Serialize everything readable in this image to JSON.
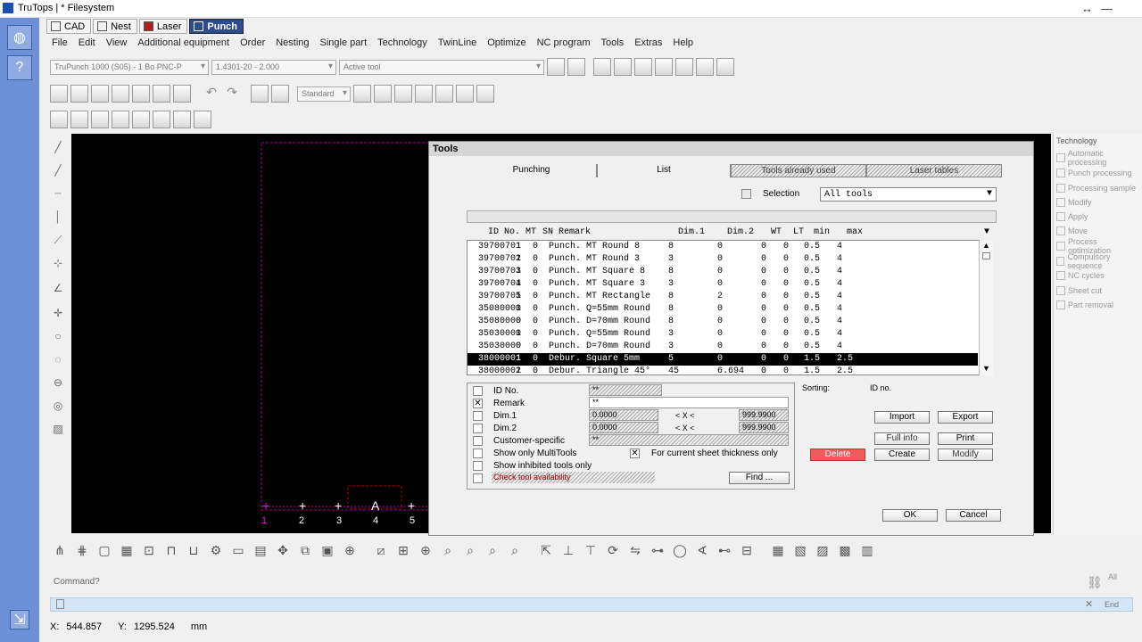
{
  "window": {
    "title": "TruTops | * Filesystem",
    "restore_icon": "restore-icon",
    "minimize_icon": "minimize-icon"
  },
  "mode_tabs": [
    {
      "label": "CAD",
      "icon": "cad-icon"
    },
    {
      "label": "Nest",
      "icon": "nest-icon"
    },
    {
      "label": "Laser",
      "icon": "laser-icon"
    },
    {
      "label": "Punch",
      "icon": "punch-icon",
      "active": true
    }
  ],
  "menu": [
    "File",
    "Edit",
    "View",
    "Additional equipment",
    "Order",
    "Nesting",
    "Single part",
    "Technology",
    "TwinLine",
    "Optimize",
    "NC program",
    "Tools",
    "Extras",
    "Help"
  ],
  "toolbar": {
    "machine": "TruPunch 1000 (S05) - 1 Bo PNC-P",
    "material": "1.4301-20 - 2.000",
    "tool": "Active tool",
    "style": "Standard"
  },
  "canvas": {
    "ruler_numbers": [
      "1",
      "2",
      "3",
      "4",
      "5"
    ]
  },
  "dialog": {
    "title": "Tools",
    "tabs": [
      {
        "label": "Punching",
        "state": "normal"
      },
      {
        "label": "List",
        "state": "active"
      },
      {
        "label": "Tools already used",
        "state": "disabled"
      },
      {
        "label": "Laser tables",
        "state": "disabled"
      }
    ],
    "selection_label": "Selection",
    "selection_value": "All tools",
    "columns": [
      "ID No.",
      "MT",
      "SN",
      "Remark",
      "Dim.1",
      "Dim.2",
      "WT",
      "LT",
      "min",
      "max"
    ],
    "rows": [
      [
        "39700701",
        "1",
        "0",
        "Punch. MT Round 8",
        "8",
        "0",
        "0",
        "0",
        "0.5",
        "4"
      ],
      [
        "39700701",
        "2",
        "0",
        "Punch. MT Round 3",
        "3",
        "0",
        "0",
        "0",
        "0.5",
        "4"
      ],
      [
        "39700701",
        "3",
        "0",
        "Punch. MT Square 8",
        "8",
        "0",
        "0",
        "0",
        "0.5",
        "4"
      ],
      [
        "39700701",
        "4",
        "0",
        "Punch. MT Square 3",
        "3",
        "0",
        "0",
        "0",
        "0.5",
        "4"
      ],
      [
        "39700701",
        "5",
        "0",
        "Punch. MT Rectangle",
        "8",
        "2",
        "0",
        "0",
        "0.5",
        "4"
      ],
      [
        "35080001",
        "0",
        "0",
        "Punch. Q=55mm Round",
        "8",
        "0",
        "0",
        "0",
        "0.5",
        "4"
      ],
      [
        "35080000",
        "0",
        "0",
        "Punch. D=70mm Round",
        "8",
        "0",
        "0",
        "0",
        "0.5",
        "4"
      ],
      [
        "35030001",
        "0",
        "0",
        "Punch. Q=55mm Round",
        "3",
        "0",
        "0",
        "0",
        "0.5",
        "4"
      ],
      [
        "35030000",
        "0",
        "0",
        "Punch. D=70mm Round",
        "3",
        "0",
        "0",
        "0",
        "0.5",
        "4"
      ],
      [
        "38000001",
        "1",
        "0",
        "Debur. Square 5mm",
        "5",
        "0",
        "0",
        "0",
        "1.5",
        "2.5"
      ],
      [
        "38000001",
        "2",
        "0",
        "Debur. Triangle 45°",
        "45",
        "6.694",
        "0",
        "0",
        "1.5",
        "2.5"
      ]
    ],
    "selected_row": 9,
    "filters": [
      {
        "label": "ID No.",
        "checked": false
      },
      {
        "label": "Remark",
        "checked": true
      },
      {
        "label": "Dim.1",
        "checked": false
      },
      {
        "label": "Dim.2",
        "checked": false
      },
      {
        "label": "Customer-specific",
        "checked": false
      },
      {
        "label": "Show only MultiTools",
        "checked": false
      },
      {
        "label": "Show inhibited tools only",
        "checked": false
      },
      {
        "label": "Check tool availability",
        "checked": false,
        "disabled": true
      }
    ],
    "id_field": "**",
    "remark_field": "**",
    "dim1_min": "0.0000",
    "dim1_op": "< X <",
    "dim1_max": "999.9900",
    "dim2_min": "0.0000",
    "dim2_op": "< X <",
    "dim2_max": "999.9900",
    "customer_field": "**",
    "sheet_thickness_label": "For current sheet thickness only",
    "sheet_thickness_checked": true,
    "find_label": "Find ...",
    "sorting_label": "Sorting:",
    "sorting_value": "ID no.",
    "buttons": {
      "import": "Import",
      "export": "Export",
      "full_info": "Full info",
      "print": "Print",
      "delete": "Delete",
      "create": "Create",
      "modify": "Modify",
      "ok": "OK",
      "cancel": "Cancel"
    }
  },
  "right_panel": {
    "title": "Technology",
    "items": [
      "Automatic processing",
      "Punch processing",
      "Processing sample",
      "Modify",
      "Apply",
      "Move",
      "Process optimization",
      "Compulsory sequence",
      "NC cycles",
      "Sheet cut",
      "Part removal"
    ]
  },
  "command": {
    "label": "Command?",
    "all_label": "All",
    "end_label": "End"
  },
  "status": {
    "x_label": "X:",
    "x_value": "544.857",
    "y_label": "Y:",
    "y_value": "1295.524",
    "unit": "mm"
  }
}
